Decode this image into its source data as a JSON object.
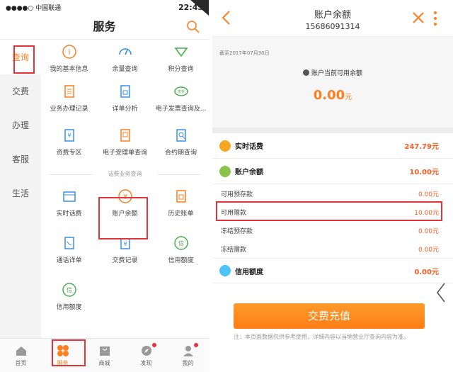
{
  "left": {
    "status": {
      "carrier": "●●●●○ 中国联通",
      "time": "22:45"
    },
    "title": "服务",
    "sidebar": [
      "查询",
      "交费",
      "办理",
      "客服",
      "生活"
    ],
    "rows": [
      [
        {
          "label": "我的基本信息",
          "icon": "info-icon"
        },
        {
          "label": "余量查询",
          "icon": "gauge-icon"
        },
        {
          "label": "积分查询",
          "icon": "points-icon"
        }
      ],
      [
        {
          "label": "业务办理记录",
          "icon": "document-icon"
        },
        {
          "label": "详单分析",
          "icon": "detail-analysis-icon"
        },
        {
          "label": "电子发票查询及...",
          "icon": "invoice-icon"
        }
      ],
      [
        {
          "label": "资费专区",
          "icon": "tariff-icon"
        },
        {
          "label": "电子受理单查询",
          "icon": "receipt-icon"
        },
        {
          "label": "合约期查询",
          "icon": "contract-icon"
        }
      ]
    ],
    "section_title": "话费业务查询",
    "rows2": [
      [
        {
          "label": "实时话费",
          "icon": "realtime-fee-icon"
        },
        {
          "label": "账户余额",
          "icon": "yuan-icon"
        },
        {
          "label": "历史账单",
          "icon": "history-bill-icon"
        }
      ],
      [
        {
          "label": "通话详单",
          "icon": "call-detail-icon"
        },
        {
          "label": "交费记录",
          "icon": "payment-record-icon"
        },
        {
          "label": "信用额度",
          "icon": "credit-icon"
        }
      ],
      [
        {
          "label": "信用额度",
          "icon": "credit-icon"
        }
      ]
    ],
    "tabbar": [
      "首页",
      "服务",
      "商城",
      "发现",
      "我的"
    ]
  },
  "right": {
    "title": "账户余额",
    "phone": "15686091314",
    "as_of": "截至2017年07月30日",
    "avail_label": "账户当前可用余额",
    "balance": "0.00",
    "balance_unit": "元",
    "lines": [
      {
        "label": "实时话费",
        "value": "247.79元",
        "color": "#f5a623"
      },
      {
        "label": "账户余额",
        "value": "10.00元",
        "color": "#8bc34a"
      }
    ],
    "sublines": [
      {
        "label": "可用预存款",
        "value": "0.00元"
      },
      {
        "label": "可用赠款",
        "value": "10.00元"
      },
      {
        "label": "冻结预存款",
        "value": "0.00元"
      },
      {
        "label": "冻结赠款",
        "value": "0.00元"
      }
    ],
    "credit": {
      "label": "信用额度",
      "value": "0.00元",
      "color": "#4fc3f7"
    },
    "button": "交费充值",
    "note": "注：本页面数据仅供参考使用，详细内容以当地营业厅查询内容为准。"
  }
}
